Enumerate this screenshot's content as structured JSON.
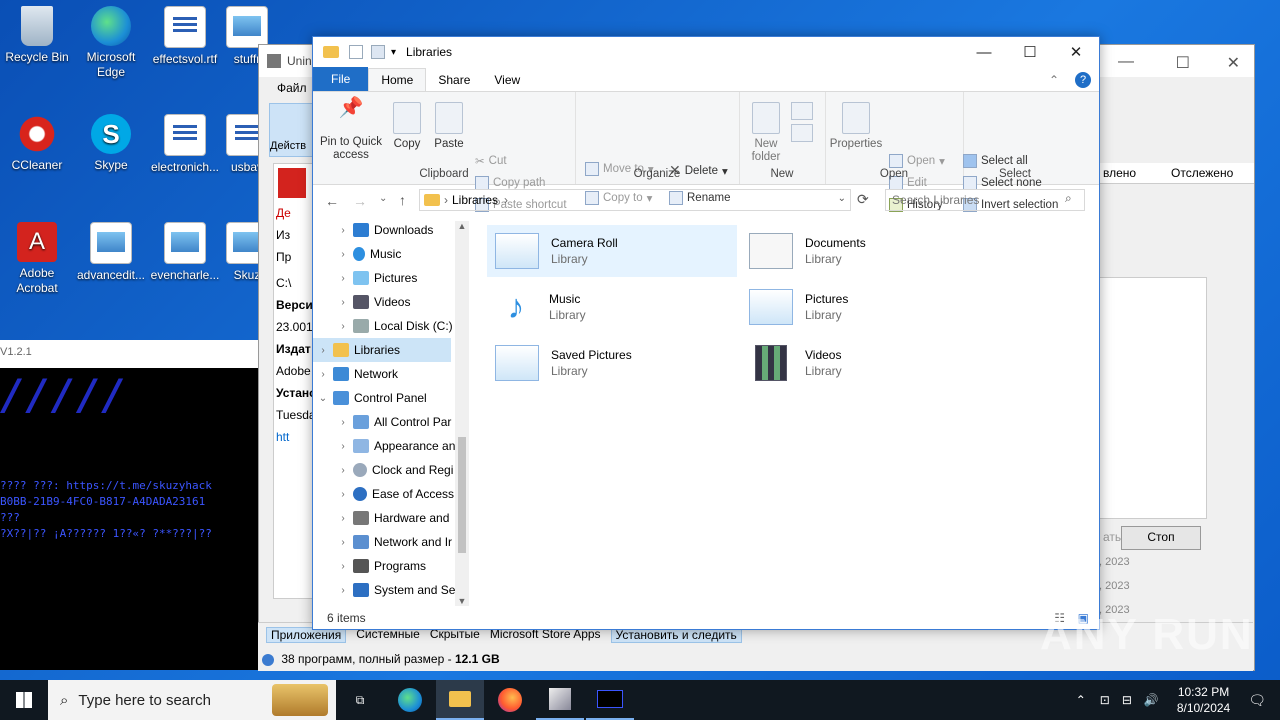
{
  "desktop": {
    "icons": [
      {
        "label": "Recycle Bin"
      },
      {
        "label": "Microsoft Edge"
      },
      {
        "label": "effectsvol.rtf"
      },
      {
        "label": "stuffr"
      },
      {
        "label": "CCleaner"
      },
      {
        "label": "Skype"
      },
      {
        "label": "electronich..."
      },
      {
        "label": "usbav"
      },
      {
        "label": "Adobe Acrobat"
      },
      {
        "label": "advancedit..."
      },
      {
        "label": "evencharle..."
      },
      {
        "label": "Skuz"
      }
    ]
  },
  "bg_window": {
    "title": "Unin",
    "menu_file": "Файл",
    "action_label": "Действ",
    "left_items": [
      "Де",
      "Из",
      "Пр"
    ],
    "path": "C:\\",
    "version_label": "Верси",
    "version_value": "23.001",
    "publisher_label": "Издат",
    "publisher_value": "Adobe",
    "installed_label": "Устано",
    "installed_value": "Tuesda",
    "link": "htt",
    "col_updated": "влено",
    "col_tracked": "Отслежено",
    "stop_button": "Стоп",
    "dim_button": "ать",
    "dates": [
      ", 2023",
      ", 2023",
      ", 2023"
    ],
    "bottom_tabs": [
      "Приложения",
      "Системные",
      "Скрытые",
      "Microsoft Store Apps",
      "Установить и следить"
    ],
    "summary_prefix": "38 программ, полный размер - ",
    "summary_size": "12.1 GB"
  },
  "console": {
    "version": "V1.2.1",
    "lines": [
      "???? ???: https://t.me/skuzyhack",
      "B0BB-21B9-4FC0-B817-A4DADA23161",
      "???",
      "?X??|?? ¡A?????? 1??«? ?**???|??"
    ]
  },
  "explorer": {
    "title": "Libraries",
    "tabs": {
      "file": "File",
      "home": "Home",
      "share": "Share",
      "view": "View"
    },
    "ribbon": {
      "clipboard": {
        "label": "Clipboard",
        "pin": "Pin to Quick access",
        "copy": "Copy",
        "paste": "Paste",
        "cut": "Cut",
        "copy_path": "Copy path",
        "paste_shortcut": "Paste shortcut"
      },
      "organize": {
        "label": "Organize",
        "move_to": "Move to",
        "copy_to": "Copy to",
        "delete": "Delete",
        "rename": "Rename"
      },
      "new": {
        "label": "New",
        "new_folder": "New folder"
      },
      "open": {
        "label": "Open",
        "properties": "Properties",
        "open": "Open",
        "edit": "Edit",
        "history": "History"
      },
      "select": {
        "label": "Select",
        "select_all": "Select all",
        "select_none": "Select none",
        "invert": "Invert selection"
      }
    },
    "address": {
      "crumb": "Libraries",
      "search_placeholder": "Search Libraries"
    },
    "tree": [
      {
        "label": "Downloads"
      },
      {
        "label": "Music"
      },
      {
        "label": "Pictures"
      },
      {
        "label": "Videos"
      },
      {
        "label": "Local Disk (C:)"
      },
      {
        "label": "Libraries"
      },
      {
        "label": "Network"
      },
      {
        "label": "Control Panel"
      },
      {
        "label": "All Control Par"
      },
      {
        "label": "Appearance an"
      },
      {
        "label": "Clock and Regi"
      },
      {
        "label": "Ease of Access"
      },
      {
        "label": "Hardware and"
      },
      {
        "label": "Network and Ir"
      },
      {
        "label": "Programs"
      },
      {
        "label": "System and Se"
      }
    ],
    "libraries": [
      {
        "name": "Camera Roll",
        "type": "Library"
      },
      {
        "name": "Documents",
        "type": "Library"
      },
      {
        "name": "Music",
        "type": "Library"
      },
      {
        "name": "Pictures",
        "type": "Library"
      },
      {
        "name": "Saved Pictures",
        "type": "Library"
      },
      {
        "name": "Videos",
        "type": "Library"
      }
    ],
    "status": "6 items"
  },
  "taskbar": {
    "search_placeholder": "Type here to search",
    "time": "10:32 PM",
    "date": "8/10/2024"
  },
  "watermark": "ANY RUN"
}
